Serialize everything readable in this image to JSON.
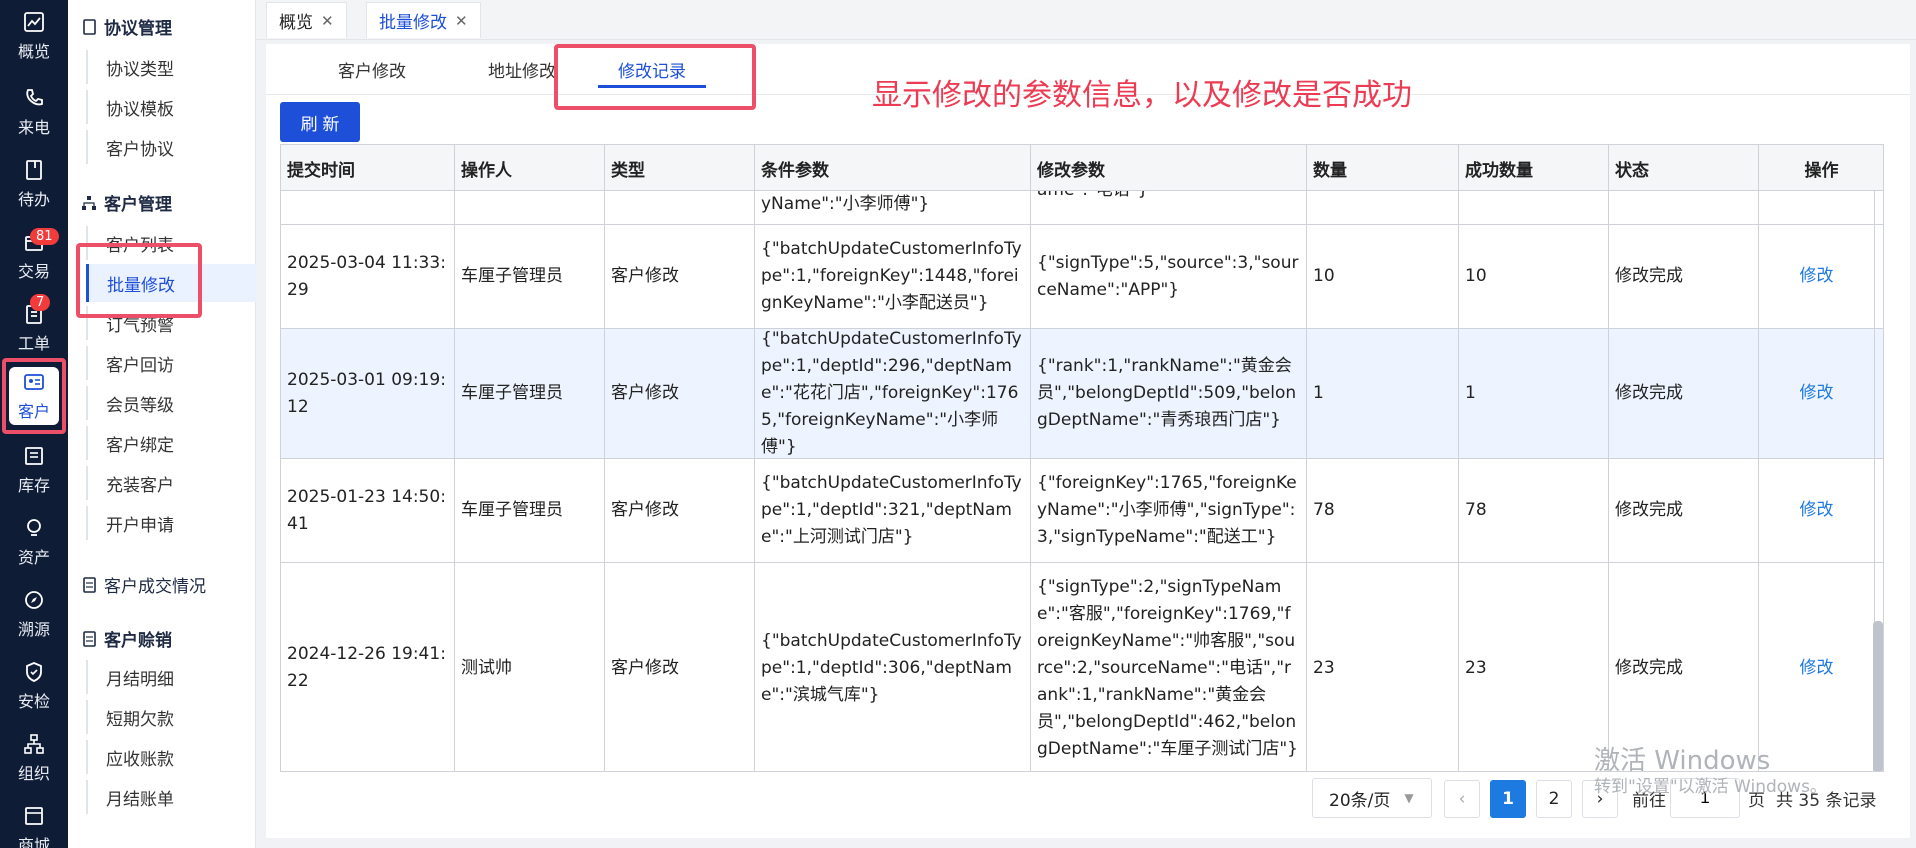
{
  "rail": {
    "items": [
      {
        "label": "概览",
        "icon": "chart-icon"
      },
      {
        "label": "来电",
        "icon": "phone-icon"
      },
      {
        "label": "待办",
        "icon": "bookmark-icon"
      },
      {
        "label": "交易",
        "icon": "trade-icon",
        "badge": "81"
      },
      {
        "label": "工单",
        "icon": "ticket-icon",
        "badge": "7"
      },
      {
        "label": "客户",
        "icon": "id-card-icon"
      },
      {
        "label": "库存",
        "icon": "list-icon"
      },
      {
        "label": "资产",
        "icon": "bulb-icon"
      },
      {
        "label": "溯源",
        "icon": "compass-icon"
      },
      {
        "label": "安检",
        "icon": "shield-icon"
      },
      {
        "label": "组织",
        "icon": "org-icon"
      },
      {
        "label": "商城",
        "icon": "shop-icon"
      }
    ]
  },
  "menu": {
    "groups": [
      {
        "title": "协议管理",
        "items": [
          "协议类型",
          "协议模板",
          "客户协议"
        ]
      },
      {
        "title": "客户管理",
        "items": [
          "客户列表",
          "批量修改",
          "订气预警",
          "客户回访",
          "会员等级",
          "客户绑定",
          "充装客户",
          "开户申请"
        ]
      },
      {
        "title": "客户成交情况",
        "items": []
      },
      {
        "title": "客户赊销",
        "items": [
          "月结明细",
          "短期欠款",
          "应收账款",
          "月结账单"
        ]
      }
    ]
  },
  "top_tabs": [
    {
      "label": "概览"
    },
    {
      "label": "批量修改"
    }
  ],
  "sub_tabs": [
    "客户修改",
    "地址修改",
    "修改记录"
  ],
  "annotation": "显示修改的参数信息，以及修改是否成功",
  "refresh_label": "刷 新",
  "table": {
    "headers": [
      "提交时间",
      "操作人",
      "类型",
      "条件参数",
      "修改参数",
      "数量",
      "成功数量",
      "状态",
      "操作"
    ],
    "partial_row": {
      "cond": "yName\":\"小李师傅\"}",
      "mod": "ame\":\"电话\"}"
    },
    "rows": [
      {
        "time": "2025-03-04 11:33:29",
        "operator": "车厘子管理员",
        "type": "客户修改",
        "cond": "{\"batchUpdateCustomerInfoType\":1,\"foreignKey\":1448,\"foreignKeyName\":\"小李配送员\"}",
        "mod": "{\"signType\":5,\"source\":3,\"sourceName\":\"APP\"}",
        "count": "10",
        "success": "10",
        "status": "修改完成",
        "action": "修改"
      },
      {
        "time": "2025-03-01 09:19:12",
        "operator": "车厘子管理员",
        "type": "客户修改",
        "cond": "{\"batchUpdateCustomerInfoType\":1,\"deptId\":296,\"deptName\":\"花花门店\",\"foreignKey\":1765,\"foreignKeyName\":\"小李师傅\"}",
        "mod": "{\"rank\":1,\"rankName\":\"黄金会员\",\"belongDeptId\":509,\"belongDeptName\":\"青秀琅西门店\"}",
        "count": "1",
        "success": "1",
        "status": "修改完成",
        "action": "修改"
      },
      {
        "time": "2025-01-23 14:50:41",
        "operator": "车厘子管理员",
        "type": "客户修改",
        "cond": "{\"batchUpdateCustomerInfoType\":1,\"deptId\":321,\"deptName\":\"上河测试门店\"}",
        "mod": "{\"foreignKey\":1765,\"foreignKeyName\":\"小李师傅\",\"signType\":3,\"signTypeName\":\"配送工\"}",
        "count": "78",
        "success": "78",
        "status": "修改完成",
        "action": "修改"
      },
      {
        "time": "2024-12-26 19:41:22",
        "operator": "测试帅",
        "type": "客户修改",
        "cond": "{\"batchUpdateCustomerInfoType\":1,\"deptId\":306,\"deptName\":\"滨城气库\"}",
        "mod": "{\"signType\":2,\"signTypeName\":\"客服\",\"foreignKey\":1769,\"foreignKeyName\":\"帅客服\",\"source\":2,\"sourceName\":\"电话\",\"rank\":1,\"rankName\":\"黄金会员\",\"belongDeptId\":462,\"belongDeptName\":\"车厘子测试门店\"}",
        "count": "23",
        "success": "23",
        "status": "修改完成",
        "action": "修改"
      }
    ]
  },
  "pagination": {
    "page_size": "20条/页",
    "pages": [
      "1",
      "2"
    ],
    "current": "1",
    "goto_label": "前往",
    "goto_value": "1",
    "page_suffix": "页",
    "total": "共 35 条记录"
  },
  "watermark": {
    "line1": "激活 Windows",
    "line2": "转到\"设置\"以激活 Windows。"
  },
  "colors": {
    "accent": "#1d4fd8",
    "highlight": "#ec4f67",
    "rail_bg": "#0f1c36"
  }
}
